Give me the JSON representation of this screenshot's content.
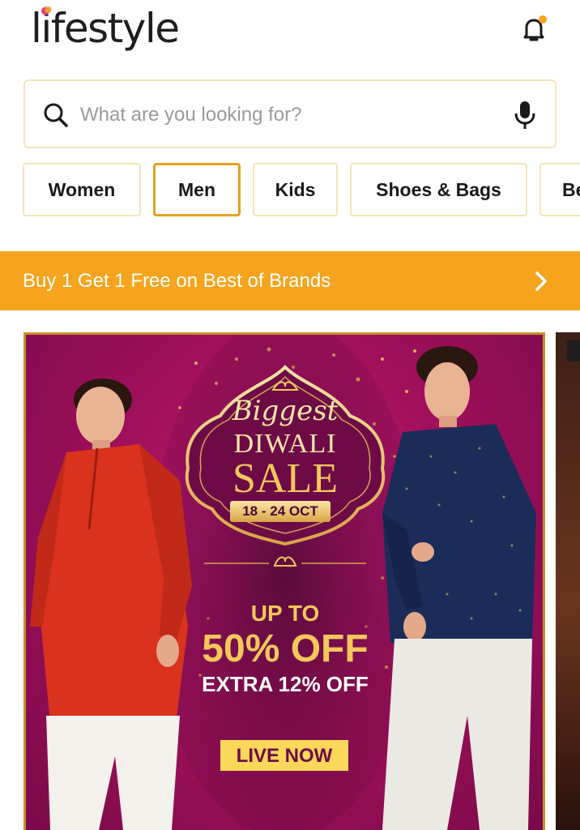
{
  "header": {
    "logo_text": "lifestyle",
    "icons": {
      "notification": "bell-icon",
      "search": "search-icon",
      "voice": "mic-icon",
      "promo_arrow": "chevron-right-icon"
    }
  },
  "search": {
    "placeholder": "What are you looking for?",
    "value": ""
  },
  "categories": [
    {
      "label": "Women"
    },
    {
      "label": "Men"
    },
    {
      "label": "Kids"
    },
    {
      "label": "Shoes & Bags"
    },
    {
      "label": "Be"
    }
  ],
  "selected_category": "Men",
  "promo": {
    "text": "Buy 1 Get 1 Free on Best of Brands"
  },
  "banner": {
    "heading_script": "Biggest",
    "heading_line": "DIWALI",
    "heading_sale": "SALE",
    "dates": "18 - 24 OCT",
    "up_to": "UP TO",
    "discount": "50% OFF",
    "extra": "EXTRA 12% OFF",
    "cta": "LIVE NOW"
  },
  "colors": {
    "accent": "#f6a41e",
    "active_border": "#e4a21f",
    "chip_border": "#f3e5b6",
    "banner_magenta": "#a3105d",
    "gold": "#f3c75a"
  }
}
